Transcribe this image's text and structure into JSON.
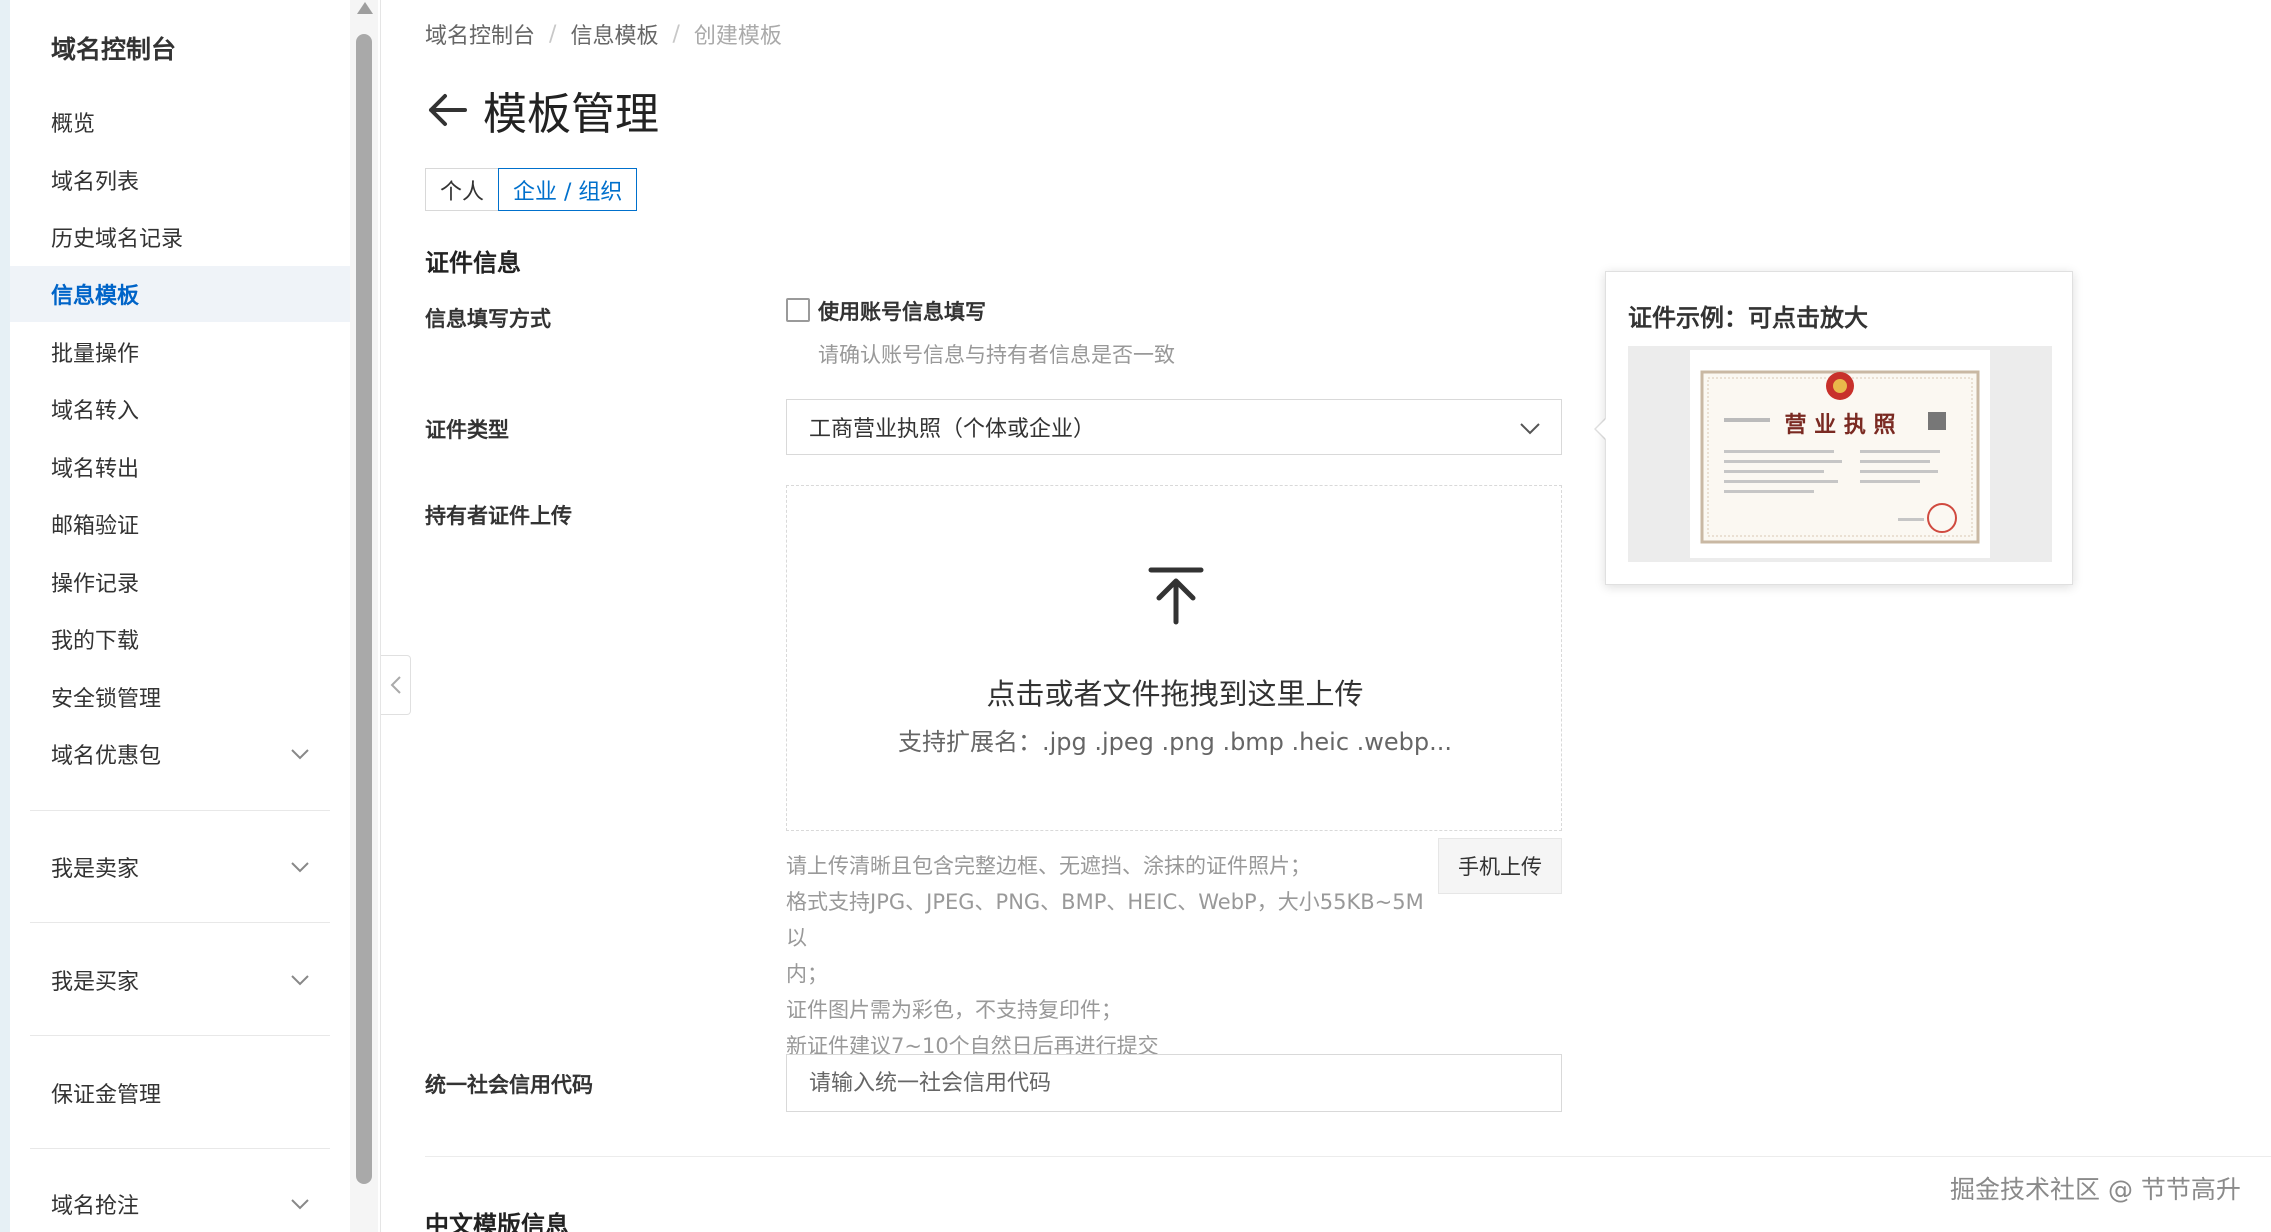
{
  "sidebar": {
    "title": "域名控制台",
    "items": [
      {
        "label": "概览"
      },
      {
        "label": "域名列表"
      },
      {
        "label": "历史域名记录"
      },
      {
        "label": "信息模板"
      },
      {
        "label": "批量操作"
      },
      {
        "label": "域名转入"
      },
      {
        "label": "域名转出"
      },
      {
        "label": "邮箱验证"
      },
      {
        "label": "操作记录"
      },
      {
        "label": "我的下载"
      },
      {
        "label": "安全锁管理"
      },
      {
        "label": "域名优惠包"
      }
    ],
    "groups": [
      {
        "label": "我是卖家"
      },
      {
        "label": "我是买家"
      },
      {
        "label": "保证金管理"
      },
      {
        "label": "域名抢注"
      }
    ],
    "active_index": 3
  },
  "breadcrumb": [
    "域名控制台",
    "信息模板",
    "创建模板"
  ],
  "breadcrumb_separator": "/",
  "page_title": "模板管理",
  "tabs": [
    {
      "label": "个人",
      "selected": false
    },
    {
      "label": "企业 / 组织",
      "selected": true
    }
  ],
  "section_cert": "证件信息",
  "fill_method": {
    "label": "信息填写方式",
    "checkbox_label": "使用账号信息填写",
    "checked": false,
    "help": "请确认账号信息与持有者信息是否一致"
  },
  "cert_type": {
    "label": "证件类型",
    "value": "工商营业执照（个体或企业）"
  },
  "upload": {
    "label": "持有者证件上传",
    "main_text": "点击或者文件拖拽到这里上传",
    "ext_text": "支持扩展名：.jpg .jpeg .png .bmp .heic .webp...",
    "tips": [
      "请上传清晰且包含完整边框、无遮挡、涂抹的证件照片；",
      "格式支持JPG、JPEG、PNG、BMP、HEIC、WebP，大小55KB~5M以",
      "内；",
      "证件图片需为彩色，不支持复印件；",
      "新证件建议7~10个自然日后再进行提交"
    ],
    "mobile_button": "手机上传"
  },
  "credit_code": {
    "label": "统一社会信用代码",
    "placeholder": "请输入统一社会信用代码",
    "value": ""
  },
  "section_cn": "中文模版信息",
  "example": {
    "title": "证件示例：可点击放大",
    "image_heading": "营 业 执 照"
  },
  "watermark": "掘金技术社区 @ 节节高升",
  "colors": {
    "accent": "#0070cc",
    "active_bg": "#eff3f8",
    "seal_red": "#c8312b"
  }
}
